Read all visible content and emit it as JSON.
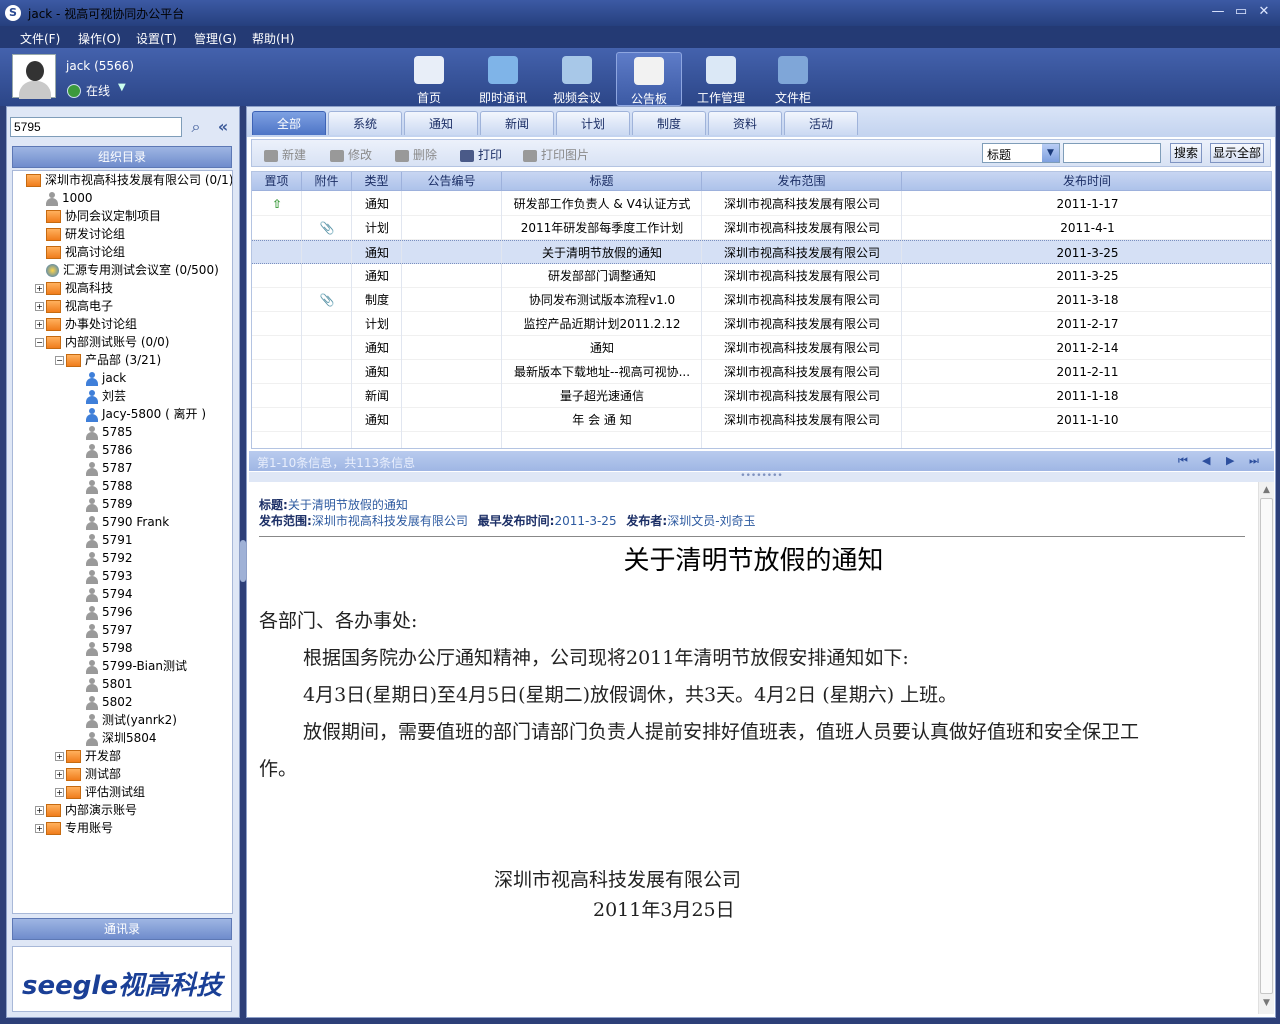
{
  "window": {
    "title": "jack - 视高可视协同办公平台",
    "logo": "S",
    "min": "—",
    "max": "▭",
    "close": "✕"
  },
  "menu": [
    "文件(F)",
    "操作(O)",
    "设置(T)",
    "管理(G)",
    "帮助(H)"
  ],
  "user": {
    "name": "jack",
    "id": "(5566)",
    "status": "在线"
  },
  "nav": [
    {
      "label": "首页",
      "icon": "home-icon",
      "color": "#e8eef8"
    },
    {
      "label": "即时通讯",
      "icon": "chat-icon",
      "color": "#7fb4e8"
    },
    {
      "label": "视频会议",
      "icon": "video-conference-icon",
      "color": "#a8c8e8"
    },
    {
      "label": "公告板",
      "icon": "bulletin-board-icon",
      "color": "#f2f2f2"
    },
    {
      "label": "工作管理",
      "icon": "work-management-icon",
      "color": "#dbe8f6"
    },
    {
      "label": "文件柜",
      "icon": "file-cabinet-icon",
      "color": "#7fa6d8"
    }
  ],
  "sidebar": {
    "search_value": "5795",
    "org_header": "组织目录",
    "contacts_header": "通讯录",
    "brand": "seegle视高科技",
    "tree": [
      {
        "label": "深圳市视高科技发展有限公司 (0/1)",
        "lvl": 0,
        "icon": "org",
        "toggle": ""
      },
      {
        "label": "1000",
        "lvl": 1,
        "icon": "person-gray",
        "toggle": ""
      },
      {
        "label": "协同会议定制项目",
        "lvl": 1,
        "icon": "org",
        "toggle": ""
      },
      {
        "label": "研发讨论组",
        "lvl": 1,
        "icon": "org",
        "toggle": ""
      },
      {
        "label": "视高讨论组",
        "lvl": 1,
        "icon": "org",
        "toggle": ""
      },
      {
        "label": "汇源专用测试会议室 (0/500)",
        "lvl": 1,
        "icon": "globe",
        "toggle": ""
      },
      {
        "label": "视高科技",
        "lvl": 1,
        "icon": "org",
        "toggle": "+"
      },
      {
        "label": "视高电子",
        "lvl": 1,
        "icon": "org",
        "toggle": "+"
      },
      {
        "label": "办事处讨论组",
        "lvl": 1,
        "icon": "org",
        "toggle": "+"
      },
      {
        "label": "内部测试账号 (0/0)",
        "lvl": 1,
        "icon": "org",
        "toggle": "-"
      },
      {
        "label": "产品部 (3/21)",
        "lvl": 2,
        "icon": "org",
        "toggle": "-"
      },
      {
        "label": "jack",
        "lvl": 3,
        "icon": "person-blue",
        "toggle": ""
      },
      {
        "label": "刘芸",
        "lvl": 3,
        "icon": "person-blue",
        "toggle": ""
      },
      {
        "label": "Jacy-5800 ( 离开 )",
        "lvl": 3,
        "icon": "person-blue",
        "toggle": ""
      },
      {
        "label": "5785",
        "lvl": 3,
        "icon": "person-gray",
        "toggle": ""
      },
      {
        "label": "5786",
        "lvl": 3,
        "icon": "person-gray",
        "toggle": ""
      },
      {
        "label": "5787",
        "lvl": 3,
        "icon": "person-gray",
        "toggle": ""
      },
      {
        "label": "5788",
        "lvl": 3,
        "icon": "person-gray",
        "toggle": ""
      },
      {
        "label": "5789",
        "lvl": 3,
        "icon": "person-gray",
        "toggle": ""
      },
      {
        "label": "5790 Frank",
        "lvl": 3,
        "icon": "person-gray",
        "toggle": ""
      },
      {
        "label": "5791",
        "lvl": 3,
        "icon": "person-gray",
        "toggle": ""
      },
      {
        "label": "5792",
        "lvl": 3,
        "icon": "person-gray",
        "toggle": ""
      },
      {
        "label": "5793",
        "lvl": 3,
        "icon": "person-gray",
        "toggle": ""
      },
      {
        "label": "5794",
        "lvl": 3,
        "icon": "person-gray",
        "toggle": ""
      },
      {
        "label": "5796",
        "lvl": 3,
        "icon": "person-gray",
        "toggle": ""
      },
      {
        "label": "5797",
        "lvl": 3,
        "icon": "person-gray",
        "toggle": ""
      },
      {
        "label": "5798",
        "lvl": 3,
        "icon": "person-gray",
        "toggle": ""
      },
      {
        "label": "5799-Bian测试",
        "lvl": 3,
        "icon": "person-gray",
        "toggle": ""
      },
      {
        "label": "5801",
        "lvl": 3,
        "icon": "person-gray",
        "toggle": ""
      },
      {
        "label": "5802",
        "lvl": 3,
        "icon": "person-gray",
        "toggle": ""
      },
      {
        "label": "测试(yanrk2)",
        "lvl": 3,
        "icon": "person-gray",
        "toggle": ""
      },
      {
        "label": "深圳5804",
        "lvl": 3,
        "icon": "person-gray",
        "toggle": ""
      },
      {
        "label": "开发部",
        "lvl": 2,
        "icon": "org",
        "toggle": "+"
      },
      {
        "label": "测试部",
        "lvl": 2,
        "icon": "org",
        "toggle": "+"
      },
      {
        "label": "评估测试组",
        "lvl": 2,
        "icon": "org",
        "toggle": "+"
      },
      {
        "label": "内部演示账号",
        "lvl": 1,
        "icon": "org",
        "toggle": "+"
      },
      {
        "label": "专用账号",
        "lvl": 1,
        "icon": "org",
        "toggle": "+"
      }
    ]
  },
  "tabs": [
    "全部",
    "系统",
    "通知",
    "新闻",
    "计划",
    "制度",
    "资料",
    "活动"
  ],
  "toolbar": {
    "new": "新建",
    "edit": "修改",
    "delete": "删除",
    "print": "打印",
    "print_image": "打印图片",
    "filter_value": "标题",
    "search": "搜索",
    "show_all": "显示全部"
  },
  "grid": {
    "columns": [
      "置项",
      "附件",
      "类型",
      "公告编号",
      "标题",
      "发布范围",
      "发布时间"
    ],
    "rows": [
      {
        "pin": "⇧",
        "attach": "",
        "type": "通知",
        "code": "",
        "title": "研发部工作负责人 & V4认证方式",
        "scope": "深圳市视高科技发展有限公司",
        "date": "2011-1-17"
      },
      {
        "pin": "",
        "attach": "📎",
        "type": "计划",
        "code": "",
        "title": "2011年研发部每季度工作计划",
        "scope": "深圳市视高科技发展有限公司",
        "date": "2011-4-1"
      },
      {
        "pin": "",
        "attach": "",
        "type": "通知",
        "code": "",
        "title": "关于清明节放假的通知",
        "scope": "深圳市视高科技发展有限公司",
        "date": "2011-3-25"
      },
      {
        "pin": "",
        "attach": "",
        "type": "通知",
        "code": "",
        "title": "研发部部门调整通知",
        "scope": "深圳市视高科技发展有限公司",
        "date": "2011-3-25"
      },
      {
        "pin": "",
        "attach": "📎",
        "type": "制度",
        "code": "",
        "title": "协同发布测试版本流程v1.0",
        "scope": "深圳市视高科技发展有限公司",
        "date": "2011-3-18"
      },
      {
        "pin": "",
        "attach": "",
        "type": "计划",
        "code": "",
        "title": "监控产品近期计划2011.2.12",
        "scope": "深圳市视高科技发展有限公司",
        "date": "2011-2-17"
      },
      {
        "pin": "",
        "attach": "",
        "type": "通知",
        "code": "",
        "title": "通知",
        "scope": "深圳市视高科技发展有限公司",
        "date": "2011-2-14"
      },
      {
        "pin": "",
        "attach": "",
        "type": "通知",
        "code": "",
        "title": "最新版本下载地址--视高可视协...",
        "scope": "深圳市视高科技发展有限公司",
        "date": "2011-2-11"
      },
      {
        "pin": "",
        "attach": "",
        "type": "新闻",
        "code": "",
        "title": "量子超光速通信",
        "scope": "深圳市视高科技发展有限公司",
        "date": "2011-1-18"
      },
      {
        "pin": "",
        "attach": "",
        "type": "通知",
        "code": "",
        "title": "年 会 通 知",
        "scope": "深圳市视高科技发展有限公司",
        "date": "2011-1-10"
      }
    ],
    "selected": 2
  },
  "pager": {
    "text": "第1-10条信息，共113条信息",
    "first": "⏮",
    "prev": "◀",
    "next": "▶",
    "last": "⏭"
  },
  "detail": {
    "title_label": "标题:",
    "title_value": "关于清明节放假的通知",
    "scope_label": "发布范围:",
    "scope_value": "深圳市视高科技发展有限公司",
    "time_label": "最早发布时间:",
    "time_value": "2011-3-25",
    "publisher_label": "发布者:",
    "publisher_value": "深圳文员-刘奇玉",
    "doc_title": "关于清明节放假的通知",
    "salutation": "各部门、各办事处:",
    "p1": "根据国务院办公厅通知精神，公司现将2011年清明节放假安排通知如下:",
    "p2": "4月3日(星期日)至4月5日(星期二)放假调休，共3天。4月2日 (星期六) 上班。",
    "p3a": "放假期间，需要值班的部门请部门负责人提前安排好值班表，值班人员要认真做好值班和安全保卫工",
    "p3b": "作。",
    "signature": "深圳市视高科技发展有限公司",
    "date": "2011年3月25日"
  }
}
